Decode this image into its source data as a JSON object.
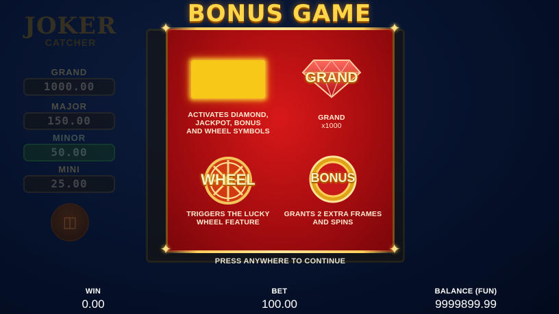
{
  "title": "BONUS GAME",
  "jackpot_panel": {
    "logo_line1": "JOKER",
    "logo_line2": "CATCHER",
    "jackpots": [
      {
        "label": "GRAND",
        "value": "1000.00"
      },
      {
        "label": "MAJOR",
        "value": "150.00"
      },
      {
        "label": "MINOR",
        "value": "50.00"
      },
      {
        "label": "MINI",
        "value": "25.00"
      }
    ],
    "basket_icon": "basket-icon"
  },
  "features": [
    {
      "icon": "glowing-frame-icon",
      "icon_word": "",
      "lines": [
        "ACTIVATES DIAMOND,",
        "JACKPOT, BONUS",
        "AND WHEEL SYMBOLS"
      ]
    },
    {
      "icon": "diamond-grand-icon",
      "icon_word": "GRAND",
      "lines": [
        "GRAND",
        "x1000"
      ]
    },
    {
      "icon": "wheel-icon",
      "icon_word": "WHEEL",
      "lines": [
        "TRIGGERS THE LUCKY",
        "WHEEL FEATURE"
      ]
    },
    {
      "icon": "bonus-coin-icon",
      "icon_word": "BONUS",
      "lines": [
        "GRANTS 2 EXTRA FRAMES",
        "AND SPINS"
      ]
    }
  ],
  "press_prompt": "PRESS ANYWHERE TO CONTINUE",
  "status_bar": {
    "win_label": "WIN",
    "win_value": "0.00",
    "bet_label": "BET",
    "bet_value": "100.00",
    "balance_label": "BALANCE (FUN)",
    "balance_value": "9999899.99"
  },
  "colors": {
    "background": "#04112b",
    "panel_red": "#c41214",
    "gold": "#ffd64a",
    "glow_yellow": "#f7c818"
  }
}
